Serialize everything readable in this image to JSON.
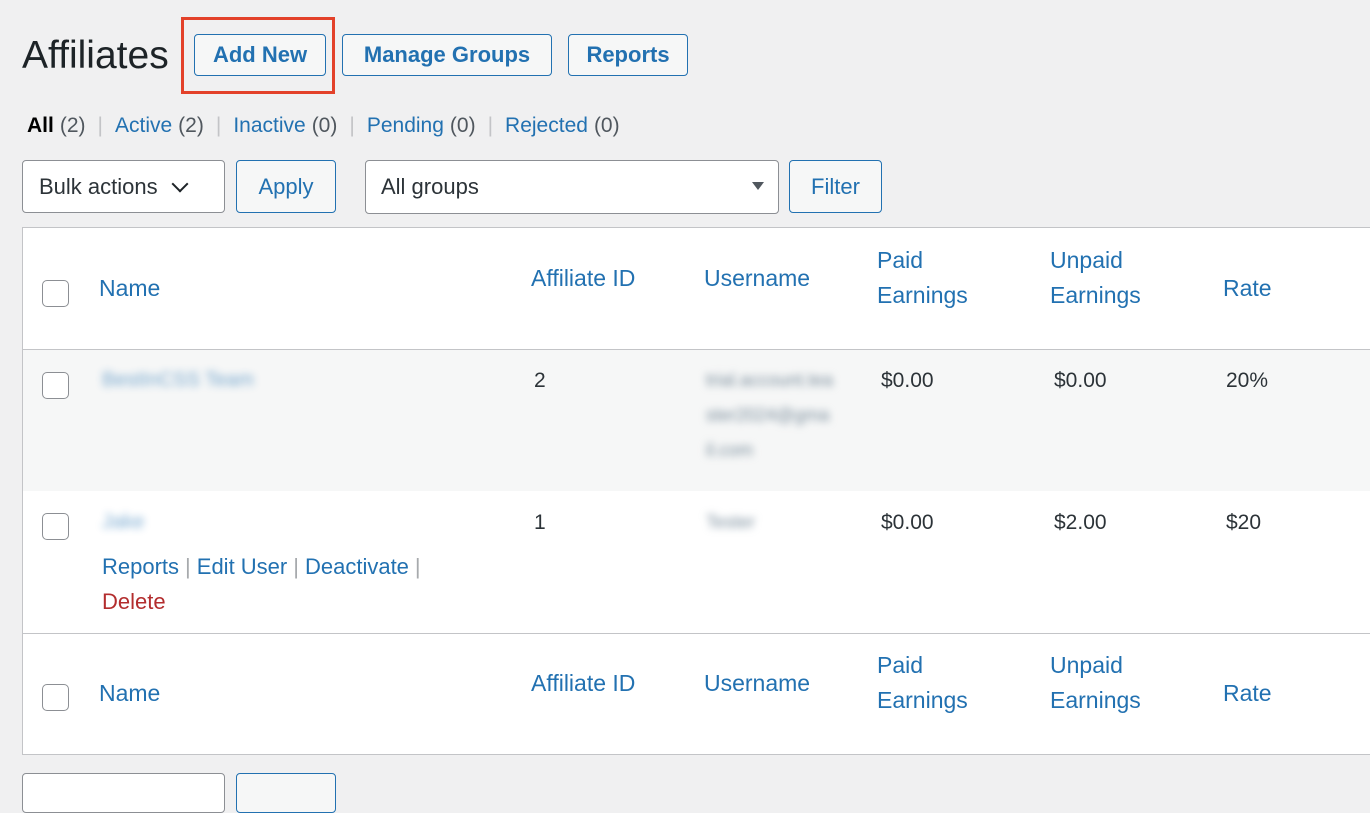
{
  "page": {
    "title": "Affiliates",
    "actions": {
      "add_new": "Add New",
      "manage_groups": "Manage Groups",
      "reports": "Reports"
    }
  },
  "views": [
    {
      "label": "All",
      "count": "(2)"
    },
    {
      "label": "Active",
      "count": "(2)"
    },
    {
      "label": "Inactive",
      "count": "(0)"
    },
    {
      "label": "Pending",
      "count": "(0)"
    },
    {
      "label": "Rejected",
      "count": "(0)"
    }
  ],
  "tablenav": {
    "bulk_actions": "Bulk actions",
    "apply": "Apply",
    "group_filter": "All groups",
    "filter": "Filter"
  },
  "columns": {
    "name": "Name",
    "affiliate_id": "Affiliate ID",
    "username": "Username",
    "paid_line1": "Paid",
    "paid_line2": "Earnings",
    "unpaid_line1": "Unpaid",
    "unpaid_line2": "Earnings",
    "rate": "Rate"
  },
  "rows": [
    {
      "name": "BestInCSS Team",
      "affiliate_id": "2",
      "username_lines": [
        "trial.account.tea",
        "ster2024@gma",
        "il.com"
      ],
      "paid": "$0.00",
      "unpaid": "$0.00",
      "rate": "20%"
    },
    {
      "name": "Jake",
      "affiliate_id": "1",
      "username_lines": [
        "Tester"
      ],
      "paid": "$0.00",
      "unpaid": "$2.00",
      "rate": "$20",
      "row_actions": {
        "reports": "Reports",
        "edit_user": "Edit User",
        "deactivate": "Deactivate",
        "delete": "Delete"
      }
    }
  ],
  "colors": {
    "link": "#2271b1",
    "delete": "#b32d2e",
    "highlight": "#e3412a",
    "background": "#f0f0f1"
  }
}
